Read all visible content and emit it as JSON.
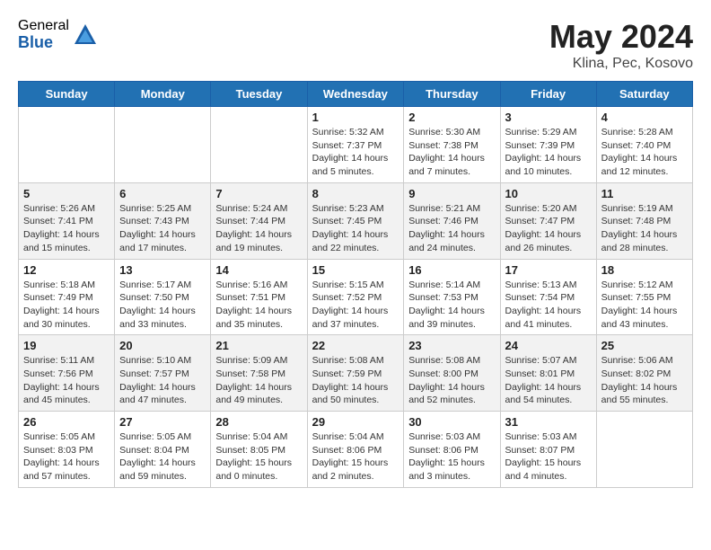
{
  "logo": {
    "general": "General",
    "blue": "Blue"
  },
  "title": "May 2024",
  "location": "Klina, Pec, Kosovo",
  "days_of_week": [
    "Sunday",
    "Monday",
    "Tuesday",
    "Wednesday",
    "Thursday",
    "Friday",
    "Saturday"
  ],
  "weeks": [
    {
      "row_class": "",
      "days": [
        {
          "number": "",
          "info": ""
        },
        {
          "number": "",
          "info": ""
        },
        {
          "number": "",
          "info": ""
        },
        {
          "number": "1",
          "sunrise": "Sunrise: 5:32 AM",
          "sunset": "Sunset: 7:37 PM",
          "daylight": "Daylight: 14 hours and 5 minutes."
        },
        {
          "number": "2",
          "sunrise": "Sunrise: 5:30 AM",
          "sunset": "Sunset: 7:38 PM",
          "daylight": "Daylight: 14 hours and 7 minutes."
        },
        {
          "number": "3",
          "sunrise": "Sunrise: 5:29 AM",
          "sunset": "Sunset: 7:39 PM",
          "daylight": "Daylight: 14 hours and 10 minutes."
        },
        {
          "number": "4",
          "sunrise": "Sunrise: 5:28 AM",
          "sunset": "Sunset: 7:40 PM",
          "daylight": "Daylight: 14 hours and 12 minutes."
        }
      ]
    },
    {
      "row_class": "alt-row",
      "days": [
        {
          "number": "5",
          "sunrise": "Sunrise: 5:26 AM",
          "sunset": "Sunset: 7:41 PM",
          "daylight": "Daylight: 14 hours and 15 minutes."
        },
        {
          "number": "6",
          "sunrise": "Sunrise: 5:25 AM",
          "sunset": "Sunset: 7:43 PM",
          "daylight": "Daylight: 14 hours and 17 minutes."
        },
        {
          "number": "7",
          "sunrise": "Sunrise: 5:24 AM",
          "sunset": "Sunset: 7:44 PM",
          "daylight": "Daylight: 14 hours and 19 minutes."
        },
        {
          "number": "8",
          "sunrise": "Sunrise: 5:23 AM",
          "sunset": "Sunset: 7:45 PM",
          "daylight": "Daylight: 14 hours and 22 minutes."
        },
        {
          "number": "9",
          "sunrise": "Sunrise: 5:21 AM",
          "sunset": "Sunset: 7:46 PM",
          "daylight": "Daylight: 14 hours and 24 minutes."
        },
        {
          "number": "10",
          "sunrise": "Sunrise: 5:20 AM",
          "sunset": "Sunset: 7:47 PM",
          "daylight": "Daylight: 14 hours and 26 minutes."
        },
        {
          "number": "11",
          "sunrise": "Sunrise: 5:19 AM",
          "sunset": "Sunset: 7:48 PM",
          "daylight": "Daylight: 14 hours and 28 minutes."
        }
      ]
    },
    {
      "row_class": "",
      "days": [
        {
          "number": "12",
          "sunrise": "Sunrise: 5:18 AM",
          "sunset": "Sunset: 7:49 PM",
          "daylight": "Daylight: 14 hours and 30 minutes."
        },
        {
          "number": "13",
          "sunrise": "Sunrise: 5:17 AM",
          "sunset": "Sunset: 7:50 PM",
          "daylight": "Daylight: 14 hours and 33 minutes."
        },
        {
          "number": "14",
          "sunrise": "Sunrise: 5:16 AM",
          "sunset": "Sunset: 7:51 PM",
          "daylight": "Daylight: 14 hours and 35 minutes."
        },
        {
          "number": "15",
          "sunrise": "Sunrise: 5:15 AM",
          "sunset": "Sunset: 7:52 PM",
          "daylight": "Daylight: 14 hours and 37 minutes."
        },
        {
          "number": "16",
          "sunrise": "Sunrise: 5:14 AM",
          "sunset": "Sunset: 7:53 PM",
          "daylight": "Daylight: 14 hours and 39 minutes."
        },
        {
          "number": "17",
          "sunrise": "Sunrise: 5:13 AM",
          "sunset": "Sunset: 7:54 PM",
          "daylight": "Daylight: 14 hours and 41 minutes."
        },
        {
          "number": "18",
          "sunrise": "Sunrise: 5:12 AM",
          "sunset": "Sunset: 7:55 PM",
          "daylight": "Daylight: 14 hours and 43 minutes."
        }
      ]
    },
    {
      "row_class": "alt-row",
      "days": [
        {
          "number": "19",
          "sunrise": "Sunrise: 5:11 AM",
          "sunset": "Sunset: 7:56 PM",
          "daylight": "Daylight: 14 hours and 45 minutes."
        },
        {
          "number": "20",
          "sunrise": "Sunrise: 5:10 AM",
          "sunset": "Sunset: 7:57 PM",
          "daylight": "Daylight: 14 hours and 47 minutes."
        },
        {
          "number": "21",
          "sunrise": "Sunrise: 5:09 AM",
          "sunset": "Sunset: 7:58 PM",
          "daylight": "Daylight: 14 hours and 49 minutes."
        },
        {
          "number": "22",
          "sunrise": "Sunrise: 5:08 AM",
          "sunset": "Sunset: 7:59 PM",
          "daylight": "Daylight: 14 hours and 50 minutes."
        },
        {
          "number": "23",
          "sunrise": "Sunrise: 5:08 AM",
          "sunset": "Sunset: 8:00 PM",
          "daylight": "Daylight: 14 hours and 52 minutes."
        },
        {
          "number": "24",
          "sunrise": "Sunrise: 5:07 AM",
          "sunset": "Sunset: 8:01 PM",
          "daylight": "Daylight: 14 hours and 54 minutes."
        },
        {
          "number": "25",
          "sunrise": "Sunrise: 5:06 AM",
          "sunset": "Sunset: 8:02 PM",
          "daylight": "Daylight: 14 hours and 55 minutes."
        }
      ]
    },
    {
      "row_class": "",
      "days": [
        {
          "number": "26",
          "sunrise": "Sunrise: 5:05 AM",
          "sunset": "Sunset: 8:03 PM",
          "daylight": "Daylight: 14 hours and 57 minutes."
        },
        {
          "number": "27",
          "sunrise": "Sunrise: 5:05 AM",
          "sunset": "Sunset: 8:04 PM",
          "daylight": "Daylight: 14 hours and 59 minutes."
        },
        {
          "number": "28",
          "sunrise": "Sunrise: 5:04 AM",
          "sunset": "Sunset: 8:05 PM",
          "daylight": "Daylight: 15 hours and 0 minutes."
        },
        {
          "number": "29",
          "sunrise": "Sunrise: 5:04 AM",
          "sunset": "Sunset: 8:06 PM",
          "daylight": "Daylight: 15 hours and 2 minutes."
        },
        {
          "number": "30",
          "sunrise": "Sunrise: 5:03 AM",
          "sunset": "Sunset: 8:06 PM",
          "daylight": "Daylight: 15 hours and 3 minutes."
        },
        {
          "number": "31",
          "sunrise": "Sunrise: 5:03 AM",
          "sunset": "Sunset: 8:07 PM",
          "daylight": "Daylight: 15 hours and 4 minutes."
        },
        {
          "number": "",
          "info": ""
        }
      ]
    }
  ]
}
